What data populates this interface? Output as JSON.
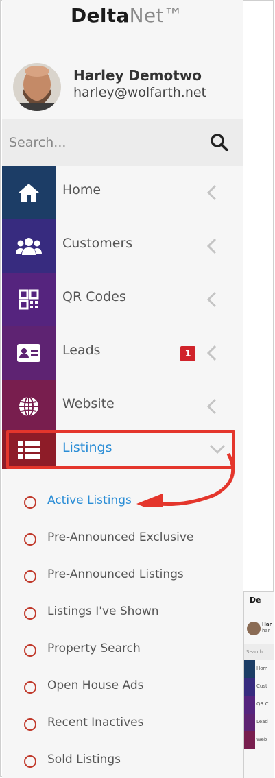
{
  "app": {
    "logo_bold": "Delta",
    "logo_light": "Net™"
  },
  "profile": {
    "name": "Harley Demotwo",
    "email": "harley@wolfarth.net"
  },
  "search": {
    "placeholder": "Search..."
  },
  "nav": {
    "items": [
      {
        "label": "Home",
        "icon": "home-icon",
        "color": "#1c3d66"
      },
      {
        "label": "Customers",
        "icon": "users-icon",
        "color": "#372b7f"
      },
      {
        "label": "QR Codes",
        "icon": "qr-code-icon",
        "color": "#55247e"
      },
      {
        "label": "Leads",
        "icon": "id-card-icon",
        "color": "#5e2372",
        "badge": "1"
      },
      {
        "label": "Website",
        "icon": "globe-icon",
        "color": "#781e4e"
      },
      {
        "label": "Listings",
        "icon": "list-icon",
        "color": "#8e1c28"
      }
    ]
  },
  "listings_submenu": [
    {
      "label": "Active Listings",
      "active": true
    },
    {
      "label": "Pre-Announced Exclusive",
      "active": false
    },
    {
      "label": "Pre-Announced Listings",
      "active": false
    },
    {
      "label": "Listings I've Shown",
      "active": false
    },
    {
      "label": "Property Search",
      "active": false
    },
    {
      "label": "Open House Ads",
      "active": false
    },
    {
      "label": "Recent Inactives",
      "active": false
    },
    {
      "label": "Sold Listings",
      "active": false
    }
  ],
  "mini_preview": {
    "logo": "De",
    "name": "Har",
    "email": "har",
    "search": "Search...",
    "items": [
      {
        "label": "Hom",
        "color": "#1c3d66"
      },
      {
        "label": "Cust",
        "color": "#372b7f"
      },
      {
        "label": "QR C",
        "color": "#55247e"
      },
      {
        "label": "Lead",
        "color": "#5e2372"
      },
      {
        "label": "Web",
        "color": "#781e4e"
      }
    ]
  },
  "colors": {
    "accent_blue": "#2a8dd6",
    "highlight_red": "#e4362c",
    "badge_red": "#d0232a"
  }
}
